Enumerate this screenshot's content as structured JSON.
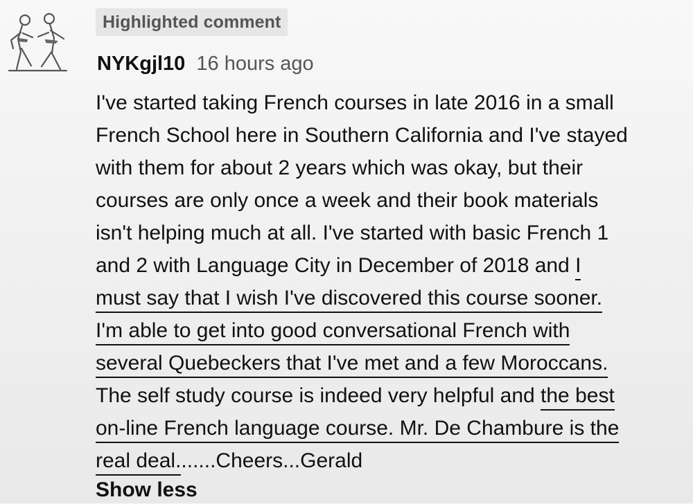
{
  "badge": {
    "label": "Highlighted comment"
  },
  "comment": {
    "author": "NYKgjl10",
    "timestamp": "16 hours ago",
    "lines": [
      {
        "text": "I've started taking French courses in late 2016 in a small"
      },
      {
        "text": "French School here in Southern California and I've stayed"
      },
      {
        "text": "with them for about 2 years which was okay, but their"
      },
      {
        "text": "courses are only once a week and their book materials"
      },
      {
        "text": "isn't helping much at all. I've started with basic French 1"
      },
      {
        "before": "and 2 with Language City in December of 2018 and ",
        "underlined": "I"
      },
      {
        "underlined": "must say that I wish I've discovered this course sooner."
      },
      {
        "underlined": "I'm able to get into good conversational French with"
      },
      {
        "underlined": "several Quebeckers that I've met and a few Moroccans."
      },
      {
        "before": "The self study course is indeed very helpful and ",
        "underlined": "the best"
      },
      {
        "underlined": "on-line French language course. Mr. De Chambure is the"
      },
      {
        "underlined": "real deal.",
        "after": "......Cheers...Gerald"
      }
    ]
  },
  "actions": {
    "show_less": "Show less"
  },
  "icons": {
    "avatar": "karate-fighters-avatar-icon"
  }
}
